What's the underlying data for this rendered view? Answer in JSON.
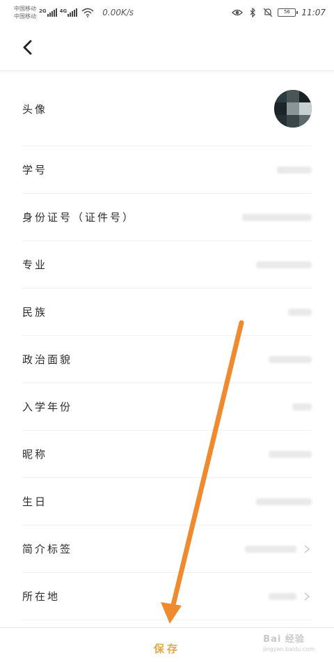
{
  "status_bar": {
    "carrier_1": "中国移动",
    "carrier_2": "中国移动",
    "network_1": "2G",
    "network_2": "4G",
    "speed": "0.00K/s",
    "battery": "56",
    "time": "11:07"
  },
  "nav": {
    "back_icon": "chevron-left-icon"
  },
  "rows": [
    {
      "label": "头像"
    },
    {
      "label": "学号"
    },
    {
      "label": "身份证号（证件号）"
    },
    {
      "label": "专业"
    },
    {
      "label": "民族"
    },
    {
      "label": "政治面貌"
    },
    {
      "label": "入学年份"
    },
    {
      "label": "昵称"
    },
    {
      "label": "生日"
    },
    {
      "label": "简介标签"
    },
    {
      "label": "所在地"
    }
  ],
  "save_label": "保存",
  "watermark": {
    "top": "Bai 经验",
    "bottom": "jingyan.baidu.com"
  },
  "colors": {
    "accent": "#e3a84a",
    "annotation_arrow": "#f08a2f"
  }
}
